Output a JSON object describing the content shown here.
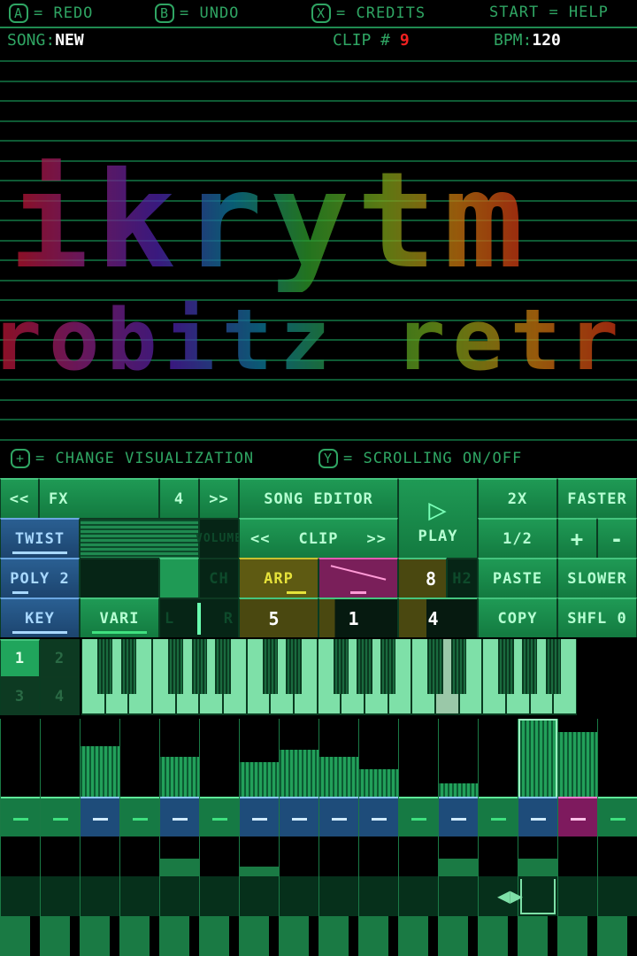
{
  "hints": [
    {
      "button": "A",
      "action": "= REDO"
    },
    {
      "button": "B",
      "action": "= UNDO"
    },
    {
      "button": "X",
      "action": "= CREDITS"
    },
    {
      "button": "START",
      "action": "= HELP"
    }
  ],
  "status": {
    "song_label": "SONG:",
    "song": "NEW",
    "clip_label": "CLIP #",
    "clip": "9",
    "bpm_label": "BPM:",
    "bpm": "120"
  },
  "visualization": {
    "line1": "ikrytm",
    "line2": "robitz retr"
  },
  "hints2": [
    {
      "button": "+",
      "action": "= CHANGE VISUALIZATION"
    },
    {
      "button": "Y",
      "action": "= SCROLLING ON/OFF"
    }
  ],
  "controls": {
    "prev": "<<",
    "fx": "FX",
    "fx_num": "4",
    "next": ">>",
    "song_editor": "SONG EDITOR",
    "play": "PLAY",
    "x2": "2X",
    "faster": "FASTER",
    "twist": "TWIST",
    "volume": "VOLUME",
    "clip_prev": "<<",
    "clip": "CLIP",
    "clip_next": ">>",
    "half": "1/2",
    "plus": "+",
    "minus": "-",
    "poly": "POLY 2",
    "ch": "CH",
    "arp": "ARP",
    "arp_value": "8",
    "h2": "H2",
    "paste": "PASTE",
    "slower": "SLOWER",
    "key": "KEY",
    "vari": "VARI",
    "pan_l": "L",
    "pan_r": "R",
    "val1": "5",
    "val2": "1",
    "val3": "4",
    "copy": "COPY",
    "shfl": "SHFL 0"
  },
  "pads": [
    "1",
    "2",
    "3",
    "4"
  ],
  "active_pad": "1",
  "steps": {
    "states": [
      "on",
      "on",
      "blue",
      "on",
      "blue",
      "on",
      "blue",
      "blue",
      "blue",
      "blue",
      "on",
      "blue",
      "on",
      "blue",
      "pink",
      "on"
    ],
    "velocity": [
      0,
      0,
      0.65,
      0,
      0.51,
      0,
      0.44,
      0.6,
      0.51,
      0.35,
      0,
      0.17,
      0,
      1.0,
      0.83,
      0
    ],
    "lower": [
      0,
      0,
      0,
      0,
      0.45,
      0,
      0.25,
      0,
      0,
      0,
      0,
      0.45,
      0,
      0.45,
      0,
      0
    ]
  },
  "colors": {
    "green": "#1f9a55",
    "blue": "#2a5f92",
    "pink": "#7a1f5a",
    "yellow": "#5e5a12"
  }
}
